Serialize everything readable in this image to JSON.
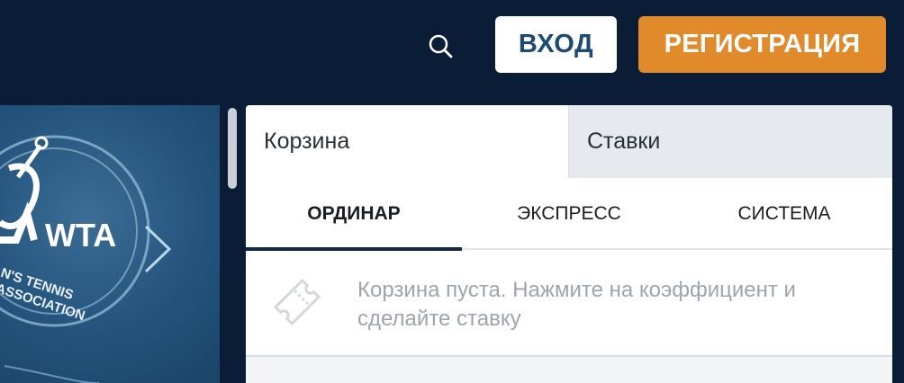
{
  "header": {
    "search_icon": "search-icon",
    "login_label": "ВХОД",
    "register_label": "РЕГИСТРАЦИЯ",
    "colors": {
      "background": "#0b1d36",
      "login_bg": "#ffffff",
      "login_text": "#1d4a73",
      "register_bg": "#e08a2c"
    }
  },
  "banner": {
    "logo_text": "WTA",
    "caption": "N'S TENNIS ASSOCIATION",
    "next_icon": "chevron-right-icon"
  },
  "betslip": {
    "tabs": [
      {
        "label": "Корзина",
        "active": true
      },
      {
        "label": "Ставки",
        "active": false
      }
    ],
    "bet_types": [
      {
        "label": "ОРДИНАР",
        "active": true
      },
      {
        "label": "ЭКСПРЕСС",
        "active": false
      },
      {
        "label": "СИСТЕМА",
        "active": false
      }
    ],
    "empty_icon": "ticket-icon",
    "empty_message": "Корзина пуста. Нажмите на коэффициент и сделайте ставку"
  }
}
